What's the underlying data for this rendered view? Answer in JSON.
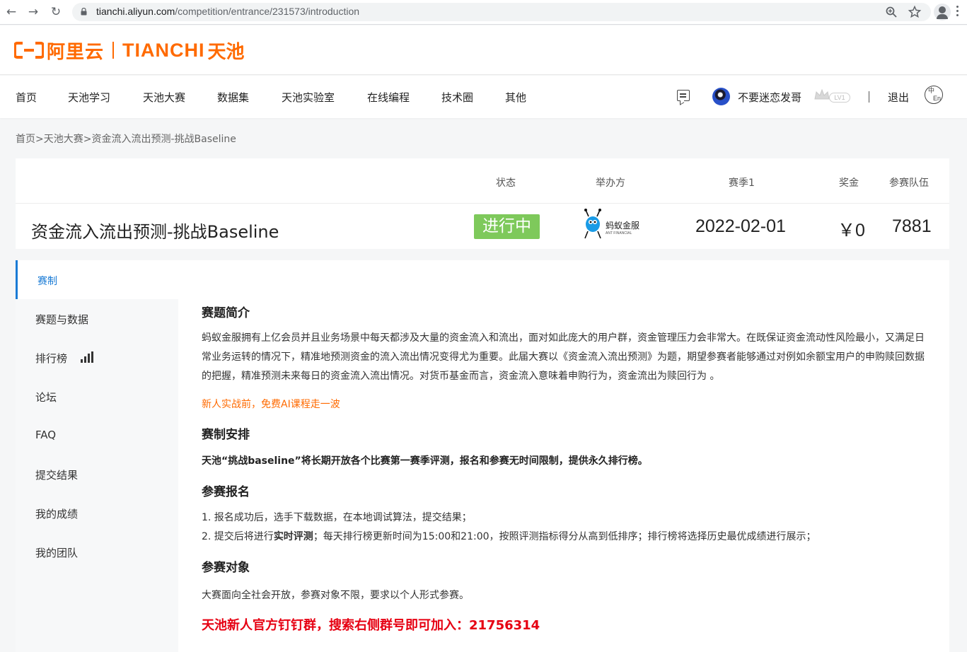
{
  "browser": {
    "url_host": "tianchi.aliyun.com",
    "url_path": "/competition/entrance/231573/introduction"
  },
  "logo": {
    "brand_cn": "阿里云",
    "brand_en": "TIANCHI",
    "brand_cn2": "天池",
    "color": "#ff6a00"
  },
  "nav": {
    "items": [
      "首页",
      "天池学习",
      "天池大赛",
      "数据集",
      "天池实验室",
      "在线编程",
      "技术圈",
      "其他"
    ],
    "user_name": "不要迷恋发哥",
    "level": "LV1",
    "divider": "|",
    "logout": "退出",
    "lang_zh": "中",
    "lang_en": "En"
  },
  "breadcrumb": "首页>天池大赛>资金流入流出预测-挑战Baseline",
  "competition": {
    "title": "资金流入流出预测-挑战Baseline",
    "labels": {
      "status": "状态",
      "organizer": "举办方",
      "season": "赛季1",
      "prize": "奖金",
      "teams": "参赛队伍"
    },
    "status": "进行中",
    "status_color": "#7ec95b",
    "organizer_name": "蚂蚁金服",
    "organizer_name_en": "ANT FINANCIAL",
    "season_date": "2022-02-01",
    "prize": "￥0",
    "teams": "7881"
  },
  "sidebar": {
    "active": "赛制",
    "items": [
      "赛题与数据",
      "排行榜",
      "论坛",
      "FAQ",
      "提交结果",
      "我的成绩",
      "我的团队"
    ]
  },
  "content": {
    "intro_title": "赛题简介",
    "intro_text": "蚂蚁金服拥有上亿会员并且业务场景中每天都涉及大量的资金流入和流出，面对如此庞大的用户群，资金管理压力会非常大。在既保证资金流动性风险最小，又满足日常业务运转的情况下，精准地预测资金的流入流出情况变得尤为重要。此届大赛以《资金流入流出预测》为题，期望参赛者能够通过对例如余额宝用户的申购赎回数据的把握，精准预测未来每日的资金流入流出情况。对货币基金而言，资金流入意味着申购行为，资金流出为赎回行为 。",
    "ai_course_link": "新人实战前，免费AI课程走一波",
    "schedule_title": "赛制安排",
    "schedule_text": "天池“挑战baseline”将长期开放各个比赛第一赛季评测，报名和参赛无时间限制，提供永久排行榜。",
    "signup_title": "参赛报名",
    "signup_1": "1. 报名成功后，选手下载数据，在本地调试算法，提交结果；",
    "signup_2_pre": "2. 提交后将进行",
    "signup_2_bold": "实时评测",
    "signup_2_post": "；每天排行榜更新时间为15:00和21:00，按照评测指标得分从高到低排序；排行榜将选择历史最优成绩进行展示；",
    "target_title": "参赛对象",
    "target_text": "大赛面向全社会开放，参赛对象不限，要求以个人形式参赛。",
    "dingtalk_text": "天池新人官方钉钉群，搜索右侧群号即可加入：21756314"
  }
}
